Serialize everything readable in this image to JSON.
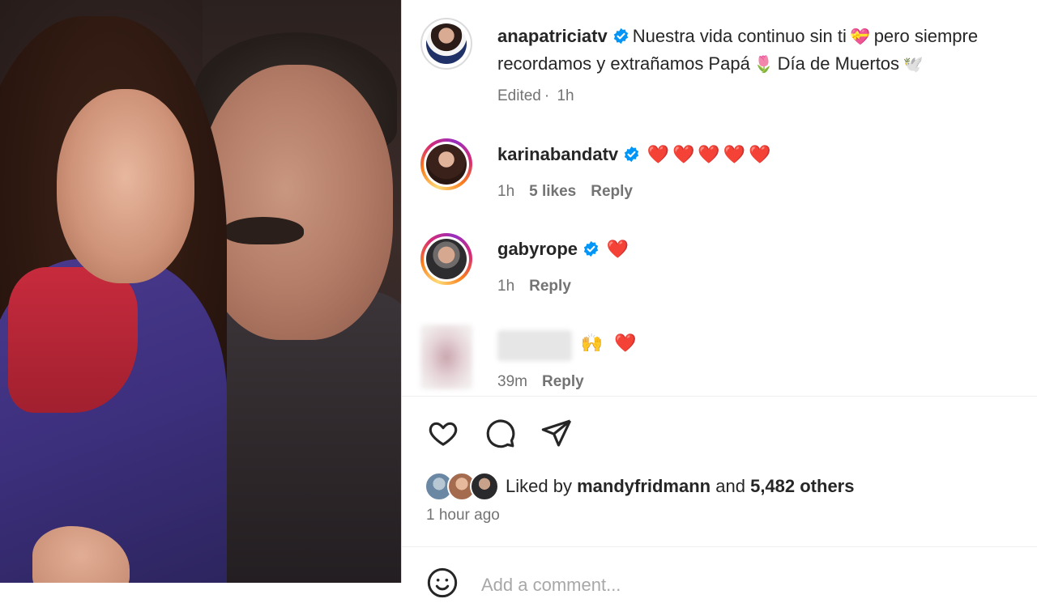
{
  "post": {
    "username": "anapatriciatv",
    "caption_line1": "Nuestra vida continuo sin ti",
    "caption_line1_emoji": "💝",
    "caption_line1_tail": "pero siempre",
    "caption_line2": "recordamos y extrañamos Papá",
    "caption_line2_emoji": "🌷",
    "caption_line2_tail": "Día de Muertos",
    "caption_line2_end_emoji": "🕊️",
    "edited": "Edited",
    "edited_time": "1h"
  },
  "comments": [
    {
      "username": "karinabandatv",
      "text": "❤️❤️❤️❤️❤️",
      "time": "1h",
      "likes": "5 likes",
      "reply": "Reply"
    },
    {
      "username": "gabyrope",
      "text": "❤️",
      "time": "1h",
      "reply": "Reply"
    },
    {
      "username": "",
      "text": "🙌 ❤️",
      "time": "39m",
      "reply": "Reply"
    }
  ],
  "likes": {
    "prefix": "Liked by",
    "user": "mandyfridmann",
    "and": "and",
    "others": "5,482 others"
  },
  "time_ago": "1 hour ago",
  "add_comment_placeholder": "Add a comment...",
  "icons": {
    "like": "heart-outline-icon",
    "comment": "comment-bubble-icon",
    "share": "paper-plane-icon",
    "verified": "verified-badge-icon",
    "emoji": "smiley-icon"
  },
  "colors": {
    "verified": "#0095f6",
    "heart": "#ff3040",
    "muted": "#737373"
  }
}
